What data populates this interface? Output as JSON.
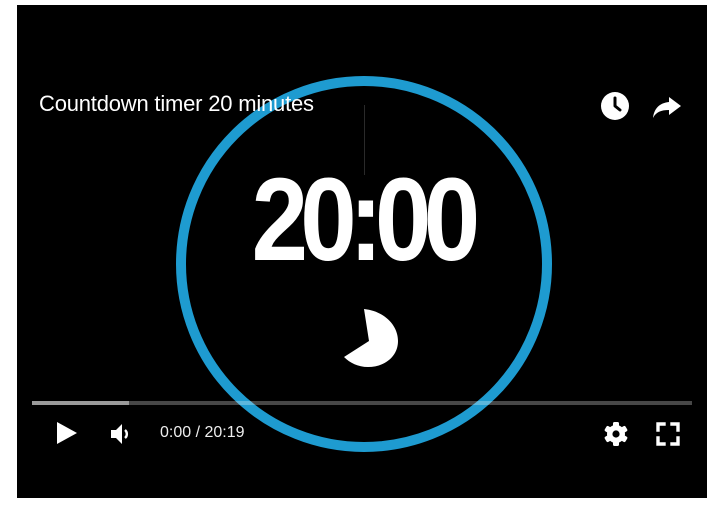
{
  "video": {
    "title": "Countdown timer 20 minutes",
    "countdown_display": "20:00",
    "progress_fraction": 0.0,
    "buffered_fraction": 0.147
  },
  "controls": {
    "time_display": "0:00 / 20:19"
  },
  "icons": {
    "top_right": [
      "clock-icon",
      "share-arrow-icon"
    ],
    "bottom_left": [
      "play-icon",
      "volume-icon"
    ],
    "bottom_right": [
      "gear-icon",
      "fullscreen-icon"
    ]
  },
  "colors": {
    "ring": "#1e9bd0",
    "background": "#000000",
    "text": "#ffffff",
    "progress_track": "#5a5a5a"
  }
}
